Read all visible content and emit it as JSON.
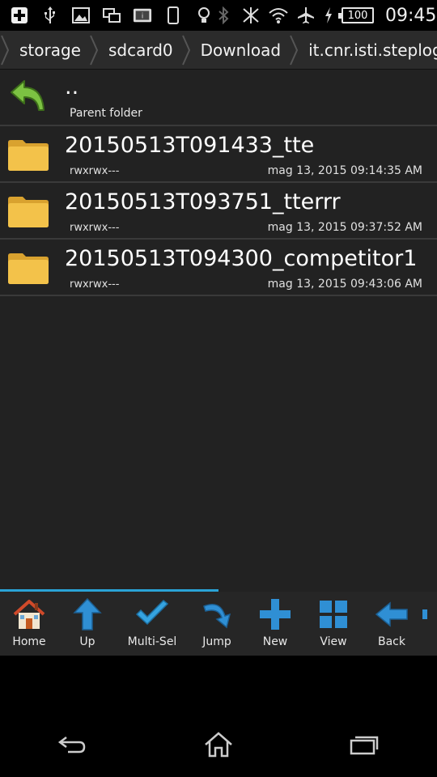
{
  "status_bar": {
    "time": "09:45",
    "battery_level": "100",
    "icons": [
      "add-icon",
      "usb-icon",
      "image-icon",
      "screen-icon",
      "sim-icon",
      "phone-icon",
      "bulb-icon",
      "bluetooth-icon",
      "no-signal-icon",
      "wifi-icon",
      "airplane-icon",
      "charging-icon",
      "battery-icon"
    ]
  },
  "breadcrumb": {
    "items": [
      "storage",
      "sdcard0",
      "Download",
      "it.cnr.isti.steplogger"
    ]
  },
  "parent": {
    "name": "..",
    "subtitle": "Parent folder"
  },
  "files": [
    {
      "name": "20150513T091433_tte",
      "perm": "rwxrwx---",
      "date": "mag 13, 2015 09:14:35 AM"
    },
    {
      "name": "20150513T093751_tterrr",
      "perm": "rwxrwx---",
      "date": "mag 13, 2015 09:37:52 AM"
    },
    {
      "name": "20150513T094300_competitor1",
      "perm": "rwxrwx---",
      "date": "mag 13, 2015 09:43:06 AM"
    }
  ],
  "scroll_progress": 0.5,
  "toolbar": {
    "items": [
      {
        "label": "Home",
        "icon": "home-icon"
      },
      {
        "label": "Up",
        "icon": "up-arrow-icon"
      },
      {
        "label": "Multi-Sel",
        "icon": "checkmark-icon"
      },
      {
        "label": "Jump",
        "icon": "jump-arrow-icon"
      },
      {
        "label": "New",
        "icon": "plus-icon"
      },
      {
        "label": "View",
        "icon": "grid-icon"
      },
      {
        "label": "Back",
        "icon": "back-arrow-icon"
      }
    ]
  },
  "colors": {
    "accent": "#2aa3d6",
    "folder": "#f3c24a",
    "list_bg": "#222222"
  }
}
